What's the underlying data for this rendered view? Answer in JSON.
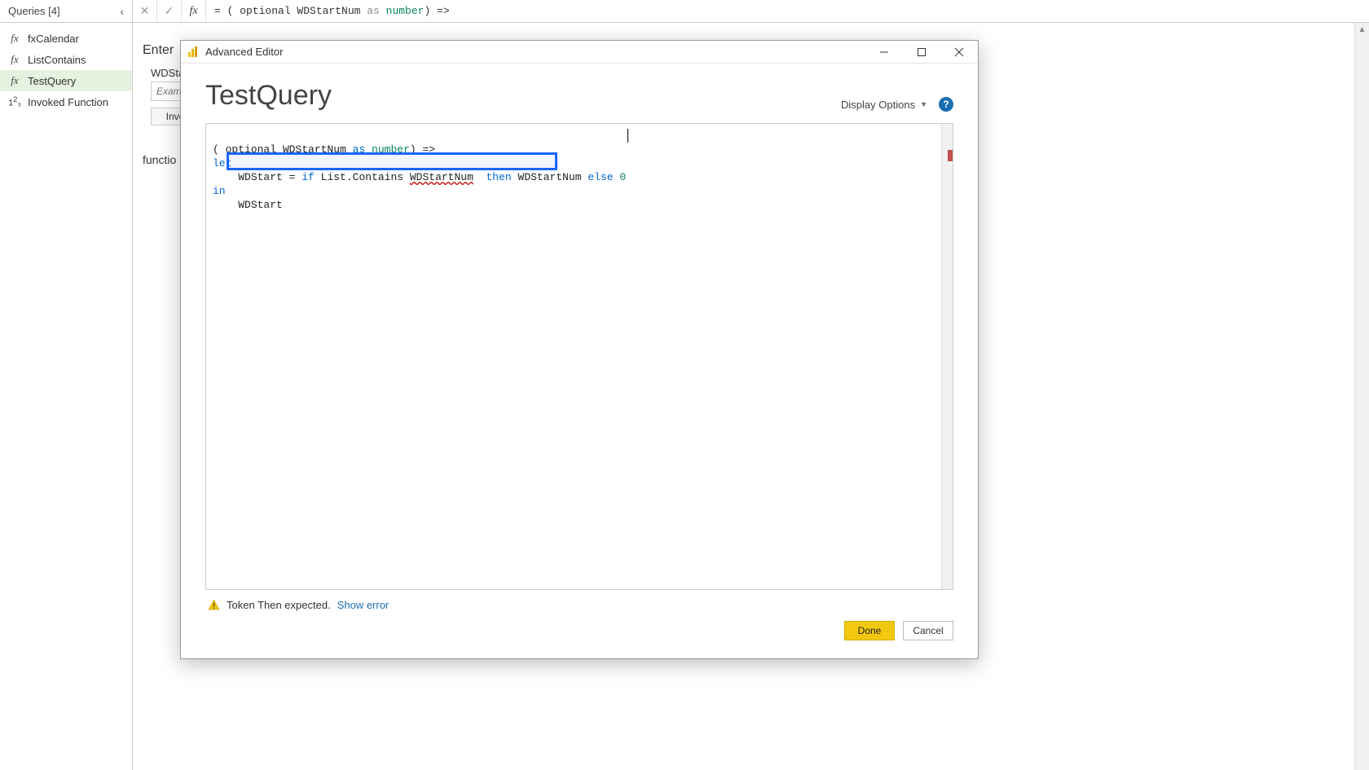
{
  "sidebar": {
    "header": "Queries [4]",
    "items": [
      {
        "icon": "fx",
        "label": "fxCalendar"
      },
      {
        "icon": "fx",
        "label": "ListContains"
      },
      {
        "icon": "fx",
        "label": "TestQuery",
        "selected": true
      },
      {
        "icon": "123",
        "label": "Invoked Function"
      }
    ]
  },
  "formula_bar": {
    "prefix": "= ( optional WDStartNum ",
    "kw_as": "as",
    "type": " number",
    "suffix": ") =>"
  },
  "background": {
    "enter_label": "Enter",
    "param_label": "WDSta",
    "param_placeholder": "Exam",
    "invoke_label": "Invo",
    "func_label": "functio"
  },
  "dialog": {
    "title": "Advanced Editor",
    "heading": "TestQuery",
    "display_options": "Display Options",
    "code": {
      "line1_a": "( optional WDStartNum ",
      "line1_as": "as",
      "line1_type": " number",
      "line1_b": ") =>",
      "line2": "let",
      "line3_a": "WDStart = ",
      "line3_if": "if",
      "line3_b": " List.Contains ",
      "line3_err": "WDStartNum",
      "line3_sp": "  ",
      "line3_then": "then",
      "line3_c": " WDStartNum ",
      "line3_else": "else",
      "line3_zero": " 0",
      "line4": "in",
      "line5": "WDStart"
    },
    "status": {
      "message": "Token Then expected.",
      "link": "Show error"
    },
    "buttons": {
      "done": "Done",
      "cancel": "Cancel"
    }
  }
}
